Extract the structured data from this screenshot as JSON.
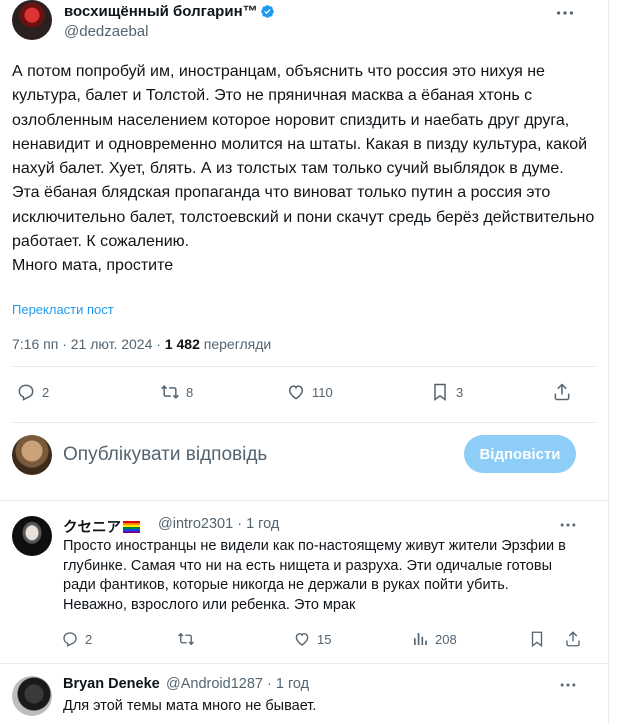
{
  "post": {
    "author_name": "восхищённый болгарин™",
    "handle": "@dedzaebal",
    "text": "А потом попробуй им, иностранцам, объяснить что россия это нихуя не культура, балет и Толстой. Это не пряничная масква а ёбаная хтонь с озлобленным населением которое норовит спиздить и наебать друг друга, ненавидит и одновременно молится на штаты. Какая в пизду культура, какой нахуй балет. Хует, блять. А из толстых там только сучий выблядок в думе.\nЭта ёбаная блядская пропаганда что виноват только путин а россия это исключительно балет, толстоевский и пони скачут средь берёз действительно работает. К сожалению.\nМного мата, простите",
    "translate_label": "Перекласти пост",
    "time": "7:16 пп",
    "date": "21 лют. 2024",
    "views": "1 482",
    "views_label": "перегляди",
    "stats": {
      "replies": "2",
      "reposts": "8",
      "likes": "110",
      "bookmarks": "3"
    }
  },
  "composer": {
    "placeholder": "Опублікувати відповідь",
    "reply_button": "Відповісти"
  },
  "replies": [
    {
      "name": "クセニア",
      "handle": "@intro2301",
      "time": "1 год",
      "text": "Просто иностранцы не видели как по-настоящему живут жители Эрзфии в глубинке. Самая что ни на есть нищета и разруха. Эти одичалые готовы ради фантиков, которые никогда не держали в руках пойти убить. Неважно, взрослого или ребенка. Это мрак",
      "stats": {
        "replies": "2",
        "likes": "15",
        "views": "208"
      }
    },
    {
      "name": "Bryan Deneke",
      "handle": "@Android1287",
      "time": "1 год",
      "text": "Для этой темы мата много не бывает."
    }
  ],
  "colors": {
    "accent": "#1d9bf0",
    "reply_button_disabled": "#8ecdf8",
    "muted_text": "#536471"
  }
}
